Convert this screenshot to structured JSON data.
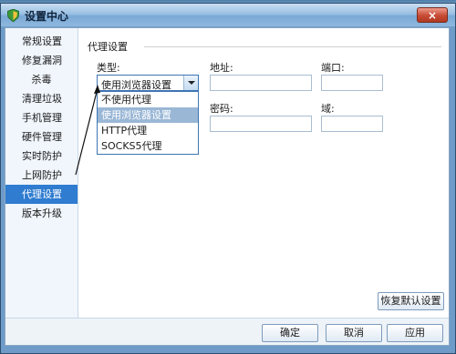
{
  "window": {
    "title": "设置中心",
    "close_label": "×"
  },
  "sidebar": {
    "items": [
      {
        "label": "常规设置"
      },
      {
        "label": "修复漏洞"
      },
      {
        "label": "杀毒"
      },
      {
        "label": "清理垃圾"
      },
      {
        "label": "手机管理"
      },
      {
        "label": "硬件管理"
      },
      {
        "label": "实时防护"
      },
      {
        "label": "上网防护"
      },
      {
        "label": "代理设置",
        "selected": true
      },
      {
        "label": "版本升级"
      }
    ]
  },
  "proxy": {
    "group_title": "代理设置",
    "type_label": "类型:",
    "type_value": "使用浏览器设置",
    "type_options": [
      "不使用代理",
      "使用浏览器设置",
      "HTTP代理",
      "SOCKS5代理"
    ],
    "address_label": "地址:",
    "address_value": "",
    "port_label": "端口:",
    "port_value": "",
    "password_label": "密码:",
    "password_value": "",
    "domain_label": "域:",
    "domain_value": "",
    "restore_default_label": "恢复默认设置"
  },
  "footer": {
    "ok_label": "确定",
    "cancel_label": "取消",
    "apply_label": "应用"
  },
  "colors": {
    "selected_item": "#2f7cd0",
    "dropdown_highlight": "#9ab7d6",
    "close_button": "#c74a33"
  }
}
